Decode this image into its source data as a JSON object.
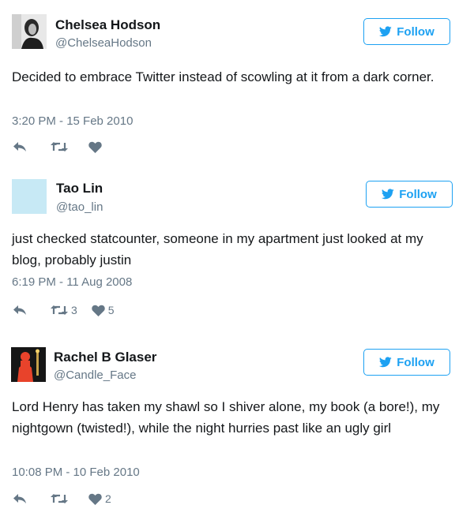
{
  "colors": {
    "accent": "#1da1f2",
    "muted": "#657786",
    "text": "#14171a"
  },
  "tweets": [
    {
      "name": "Chelsea Hodson",
      "handle": "@ChelseaHodson",
      "follow_label": "Follow",
      "text": "Decided to embrace Twitter instead of scowling at it from a dark corner.",
      "timestamp": "3:20 PM - 15 Feb 2010",
      "retweets": "",
      "likes": "",
      "avatar_icon": "woman-portrait-photo"
    },
    {
      "name": "Tao Lin",
      "handle": "@tao_lin",
      "follow_label": "Follow",
      "text": "just checked statcounter, someone in my apartment just looked at my blog, probably justin",
      "timestamp": "6:19 PM - 11 Aug 2008",
      "retweets": "3",
      "likes": "5",
      "avatar_icon": "light-blue-square"
    },
    {
      "name": "Rachel B Glaser",
      "handle": "@Candle_Face",
      "follow_label": "Follow",
      "text": "Lord Henry has taken my shawl so I shiver alone, my book (a bore!), my nightgown (twisted!), while the night hurries past like an ugly girl",
      "timestamp": "10:08 PM - 10 Feb 2010",
      "retweets": "",
      "likes": "2",
      "avatar_icon": "red-figure-candle-photo"
    }
  ]
}
